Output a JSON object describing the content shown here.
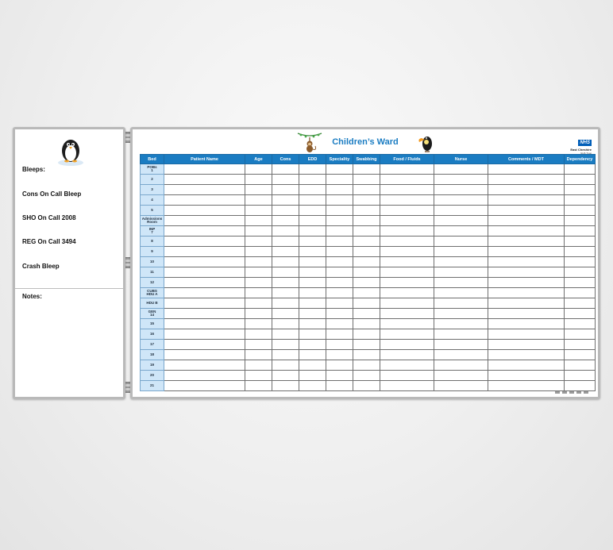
{
  "left_board": {
    "bleeps": [
      "Bleeps:",
      "Cons On Call Bleep",
      "SHO On Call 2008",
      "REG On Call 3494",
      "Crash Bleep"
    ],
    "notes_label": "Notes:"
  },
  "ward": {
    "title": "Children’s Ward",
    "nhs_logo": "NHS",
    "trust_name": "East Cheshire",
    "trust_sub": "NHS Trust"
  },
  "table": {
    "headers": [
      "Bed",
      "Patient Name",
      "Age",
      "Cons",
      "EDD",
      "Speciality",
      "Swabbing",
      "Food / Fluids",
      "Nurse",
      "Comments / MDT",
      "Dependency"
    ],
    "beds": [
      [
        "POBs",
        "1"
      ],
      [
        "2"
      ],
      [
        "3"
      ],
      [
        "4"
      ],
      [
        "5"
      ],
      [
        "Admissions",
        "Room"
      ],
      [
        "INP",
        "7"
      ],
      [
        "8"
      ],
      [
        "9"
      ],
      [
        "10"
      ],
      [
        "11"
      ],
      [
        "12"
      ],
      [
        "CUBS",
        "HDU A"
      ],
      [
        "HDU B"
      ],
      [
        "GEN",
        "14"
      ],
      [
        "15"
      ],
      [
        "16"
      ],
      [
        "17"
      ],
      [
        "18"
      ],
      [
        "19"
      ],
      [
        "20"
      ],
      [
        "21"
      ]
    ]
  },
  "icons": {
    "left_mascot": "penguin-icon",
    "monkey": "monkey-icon",
    "toucan": "toucan-icon"
  },
  "colors": {
    "accent": "#1a7cc2",
    "bed_cell": "#cfe6f8",
    "board_frame": "#b9b9b9"
  }
}
